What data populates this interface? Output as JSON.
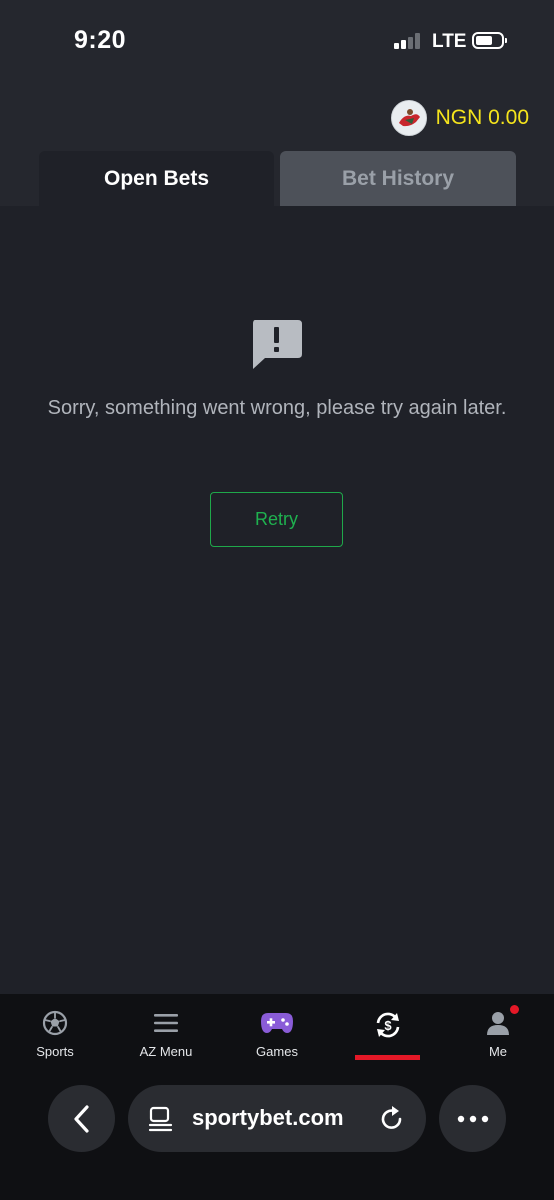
{
  "status_bar": {
    "time": "9:20",
    "network": "LTE"
  },
  "header": {
    "balance": "NGN 0.00",
    "balance_color": "#f5e41c"
  },
  "tabs": [
    {
      "label": "Open Bets",
      "active": true
    },
    {
      "label": "Bet History",
      "active": false
    }
  ],
  "error": {
    "message": "Sorry, something went wrong, please try again later.",
    "retry_label": "Retry",
    "accent_color": "#1fb14f"
  },
  "bottom_nav": {
    "items": [
      {
        "label": "Sports",
        "icon": "soccer-ball-icon"
      },
      {
        "label": "AZ Menu",
        "icon": "menu-icon"
      },
      {
        "label": "Games",
        "icon": "gamepad-icon"
      },
      {
        "label": "",
        "icon": "cashout-icon",
        "active": true
      },
      {
        "label": "Me",
        "icon": "user-icon",
        "notification": true
      }
    ],
    "active_color": "#e41827"
  },
  "browser": {
    "url": "sportybet.com"
  }
}
